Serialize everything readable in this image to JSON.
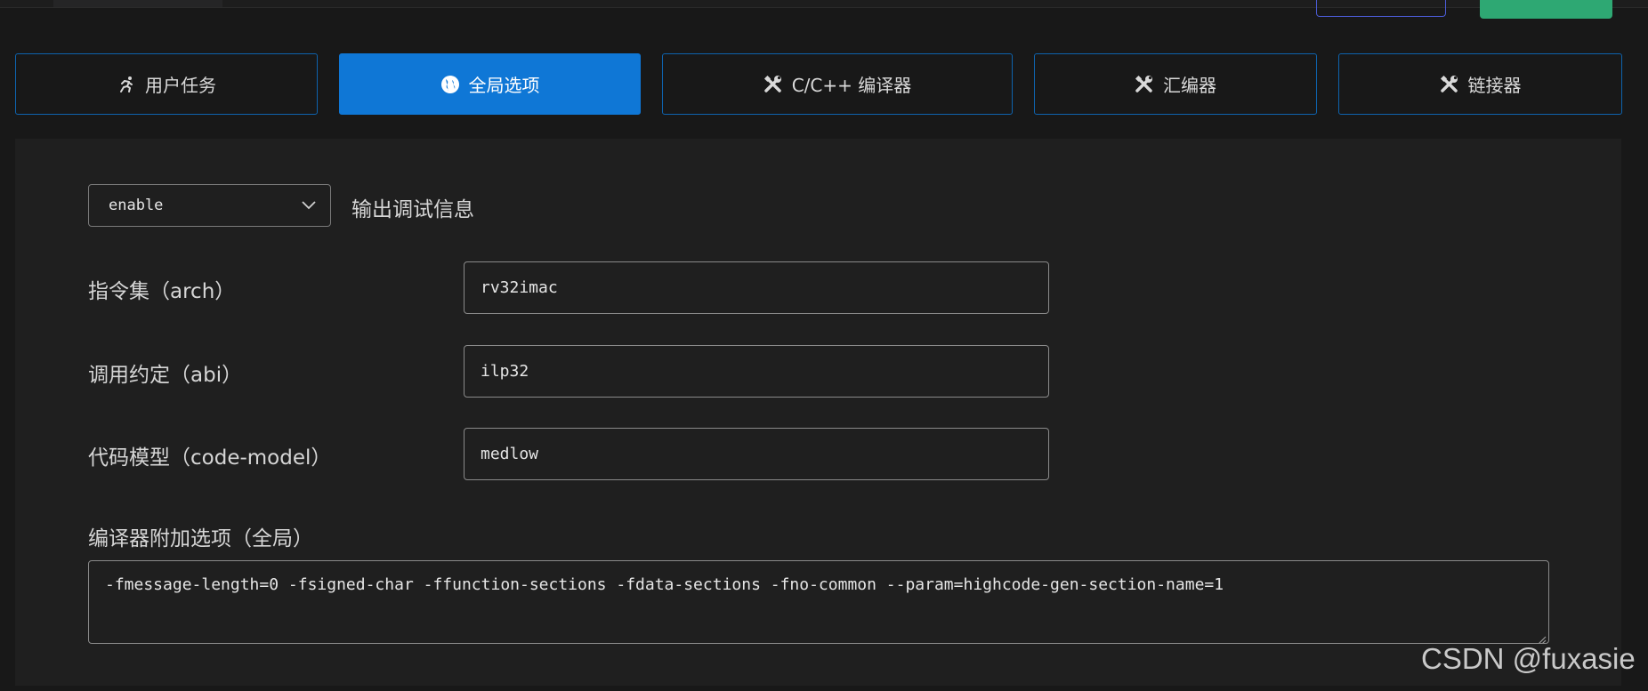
{
  "tabs": [
    {
      "label": "用户任务",
      "icon": "run-icon",
      "active": false
    },
    {
      "label": "全局选项",
      "icon": "globe-icon",
      "active": true
    },
    {
      "label": "C/C++ 编译器",
      "icon": "tools-icon",
      "active": false
    },
    {
      "label": "汇编器",
      "icon": "tools-icon",
      "active": false
    },
    {
      "label": "链接器",
      "icon": "tools-icon",
      "active": false
    }
  ],
  "debug": {
    "value": "enable",
    "label": "输出调试信息"
  },
  "fields": {
    "arch": {
      "label": "指令集（arch）",
      "value": "rv32imac"
    },
    "abi": {
      "label": "调用约定（abi）",
      "value": "ilp32"
    },
    "code_model": {
      "label": "代码模型（code-model）",
      "value": "medlow"
    }
  },
  "extra_options": {
    "label": "编译器附加选项（全局）",
    "value": "-fmessage-length=0 -fsigned-char -ffunction-sections -fdata-sections -fno-common --param=highcode-gen-section-name=1"
  },
  "watermark": "CSDN @fuxasie",
  "colors": {
    "accent": "#0f77d6",
    "border_blue": "#0e63ad",
    "green": "#2ea873",
    "background": "#181818",
    "panel": "#1f1f1f"
  }
}
